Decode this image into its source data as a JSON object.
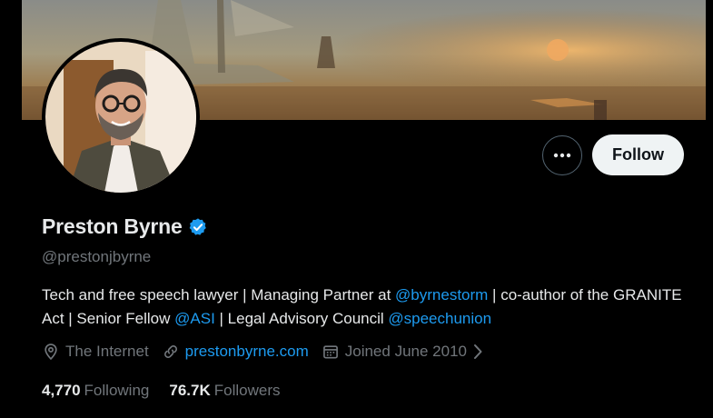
{
  "profile": {
    "display_name": "Preston Byrne",
    "handle": "@prestonjbyrne",
    "verified": true,
    "bio_parts": {
      "p1": "Tech and free speech lawyer | Managing Partner at ",
      "m1": "@byrnestorm",
      "p2": " | co-author of the GRANITE Act | Senior Fellow ",
      "m2": "@ASI",
      "p3": " | Legal Advisory Council ",
      "m3": "@speechunion"
    },
    "location": "The Internet",
    "website": "prestonbyrne.com",
    "joined": "Joined June 2010",
    "following_count": "4,770",
    "following_label": "Following",
    "followers_count": "76.7K",
    "followers_label": "Followers"
  },
  "actions": {
    "follow_label": "Follow",
    "more_icon": "more-dots-icon"
  },
  "colors": {
    "background": "#000000",
    "text_primary": "#e7e9ea",
    "text_secondary": "#71767b",
    "accent": "#1d9bf0",
    "follow_button_bg": "#eff3f4"
  }
}
